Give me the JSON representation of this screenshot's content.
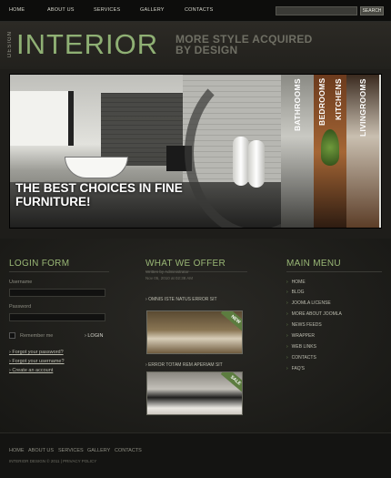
{
  "nav": {
    "items": [
      "HOME",
      "ABOUT US",
      "SERVICES",
      "GALLERY",
      "CONTACTS"
    ],
    "search_button": "SEARCH"
  },
  "header": {
    "logo_small": "DESIGN",
    "logo_big": "INTERIOR",
    "tagline": "MORE STYLE ACQUIRED BY DESIGN"
  },
  "banner": {
    "caption": "THE BEST CHOICES IN FINE FURNITURE!",
    "categories": [
      "BATHROOMS",
      "BEDROOMS",
      "KITCHENS",
      "LIVINGROOMS"
    ]
  },
  "login": {
    "title": "LOGIN FORM",
    "username_label": "Username",
    "password_label": "Password",
    "remember_label": "Remember me",
    "login_button": "LOGIN",
    "links": [
      "Forgot your password?",
      "Forgot your username?",
      "Create an account"
    ]
  },
  "offer": {
    "title": "WHAT WE OFFER",
    "meta_line1": "Written by Administrator",
    "meta_line2": "Nov 05, 2010 at 02:38 AM",
    "items": [
      {
        "title": "OMNIS ISTE NATUS ERROR SIT",
        "badge": "NEW"
      },
      {
        "title": "ERROR TOTAM REM APERIAM SIT",
        "badge": "SALE"
      }
    ]
  },
  "menu": {
    "title": "MAIN MENU",
    "items": [
      "HOME",
      "BLOG",
      "JOOMLA LICENSE",
      "MORE ABOUT JOOMLA",
      "NEWS FEEDS",
      "WRAPPER",
      "WEB LINKS",
      "CONTACTS",
      "FAQ'S"
    ]
  },
  "footer": {
    "links": [
      "HOME",
      "ABOUT US",
      "SERVICES",
      "GALLERY",
      "CONTACTS"
    ],
    "copyright": "INTERIOR DESIGN © 2011 | PRIVACY POLICY"
  },
  "colors": {
    "accent_green": "#8fb074",
    "background": "#1e1d1a"
  }
}
